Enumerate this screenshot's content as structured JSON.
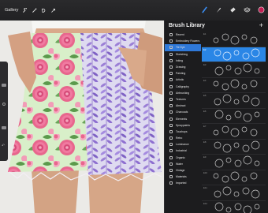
{
  "toolbar": {
    "gallery_label": "Gallery",
    "left_icons": [
      "wrench-icon",
      "wand-icon",
      "selection-icon",
      "transform-icon"
    ],
    "right_icons": [
      "brush-icon",
      "smudge-icon",
      "eraser-icon",
      "layers-icon"
    ],
    "active_color": "#c21d52"
  },
  "brush_library": {
    "title": "Brush Library",
    "add_label": "+",
    "categories": [
      {
        "label": "Recent",
        "selected": false
      },
      {
        "label": "Embroidery Flowers",
        "selected": false
      },
      {
        "label": "Tie Dye",
        "selected": true
      },
      {
        "label": "Sketching",
        "selected": false
      },
      {
        "label": "Inking",
        "selected": false
      },
      {
        "label": "Drawing",
        "selected": false
      },
      {
        "label": "Painting",
        "selected": false
      },
      {
        "label": "Artistic",
        "selected": false
      },
      {
        "label": "Calligraphy",
        "selected": false
      },
      {
        "label": "Airbrushing",
        "selected": false
      },
      {
        "label": "Textures",
        "selected": false
      },
      {
        "label": "Abstract",
        "selected": false
      },
      {
        "label": "Charcoals",
        "selected": false
      },
      {
        "label": "Elements",
        "selected": false
      },
      {
        "label": "Spraypaints",
        "selected": false
      },
      {
        "label": "Touchups",
        "selected": false
      },
      {
        "label": "Retro",
        "selected": false
      },
      {
        "label": "Luminance",
        "selected": false
      },
      {
        "label": "Industrial",
        "selected": false
      },
      {
        "label": "Organic",
        "selected": false
      },
      {
        "label": "Water",
        "selected": false
      },
      {
        "label": "Vintage",
        "selected": false
      },
      {
        "label": "Materials",
        "selected": false
      },
      {
        "label": "Imported",
        "selected": false
      }
    ],
    "brushes": [
      {
        "name": "E1",
        "selected": false
      },
      {
        "name": "E2",
        "selected": true
      },
      {
        "name": "E3",
        "selected": false
      },
      {
        "name": "E4",
        "selected": false
      },
      {
        "name": "E5",
        "selected": false
      },
      {
        "name": "E6",
        "selected": false
      },
      {
        "name": "E7",
        "selected": false
      },
      {
        "name": "E8",
        "selected": false
      },
      {
        "name": "E9",
        "selected": false
      },
      {
        "name": "E10",
        "selected": false
      },
      {
        "name": "E11",
        "selected": false
      },
      {
        "name": "E12",
        "selected": false
      }
    ]
  },
  "colors": {
    "rose_pink": "#e8668d",
    "rose_light": "#f5a8c0",
    "leaf_green": "#6aa55a",
    "lavender": "#9b7fd6",
    "lavender_dark": "#6d4fb8",
    "skin": "#d9a98a"
  }
}
